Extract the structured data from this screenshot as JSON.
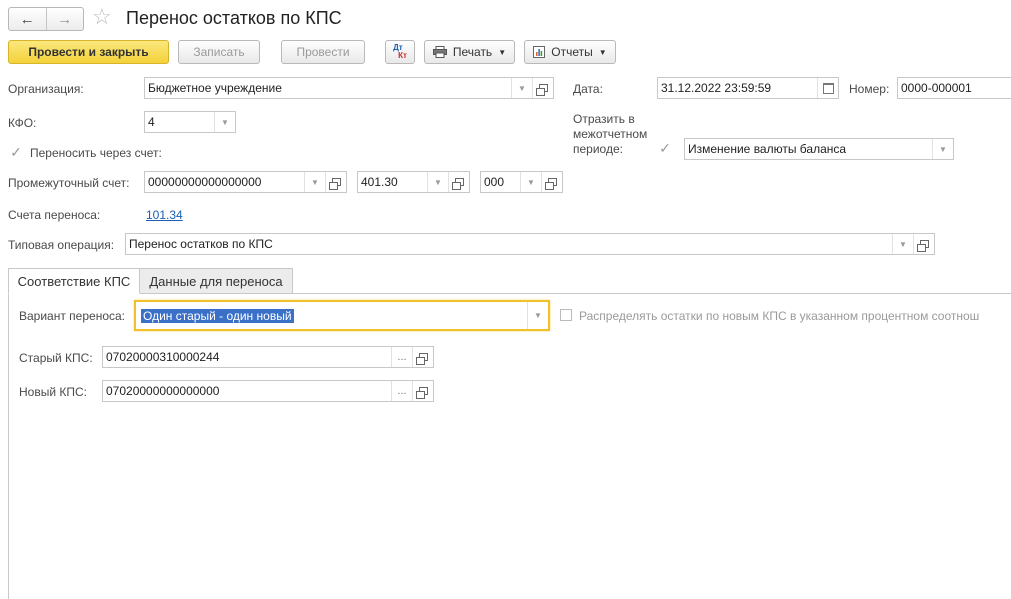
{
  "window": {
    "title": "Перенос остатков по КПС"
  },
  "nav": {
    "back_icon": "arrow-left-icon",
    "forward_icon": "arrow-right-icon",
    "favorite_icon": "star-icon"
  },
  "toolbar": {
    "post_and_close": "Провести и закрыть",
    "save": "Записать",
    "post": "Провести",
    "dt_kt_top": "Дт",
    "dt_kt_bottom": "Кт",
    "print": "Печать",
    "reports": "Отчеты"
  },
  "header": {
    "org_label": "Организация:",
    "org_value": "Бюджетное учреждение",
    "date_label": "Дата:",
    "date_value": "31.12.2022 23:59:59",
    "number_label": "Номер:",
    "number_value": "0000-000001",
    "kfo_label": "КФО:",
    "kfo_value": "4",
    "reflect_label_1": "Отразить в",
    "reflect_label_2": "межотчетном",
    "reflect_label_3": "периоде:",
    "reflect_value": "Изменение валюты баланса",
    "transfer_via_account_label": "Переносить через счет:",
    "intermediate_label": "Промежуточный счет:",
    "intermediate_kps": "00000000000000000",
    "intermediate_account": "401.30",
    "intermediate_kosgu": "000",
    "transfer_accounts_label": "Счета переноса:",
    "transfer_accounts_value": "101.34",
    "typical_op_label": "Типовая операция:",
    "typical_op_value": "Перенос остатков по КПС"
  },
  "tabs": [
    {
      "label": "Соответствие КПС"
    },
    {
      "label": "Данные для переноса"
    }
  ],
  "tab_content": {
    "variant_label": "Вариант переноса:",
    "variant_value": "Один старый - один новый",
    "distribute_label": "Распределять остатки по новым КПС в указанном процентном соотнош",
    "old_kps_label": "Старый КПС:",
    "old_kps_value": "07020000310000244",
    "new_kps_label": "Новый КПС:",
    "new_kps_value": "07020000000000000"
  }
}
